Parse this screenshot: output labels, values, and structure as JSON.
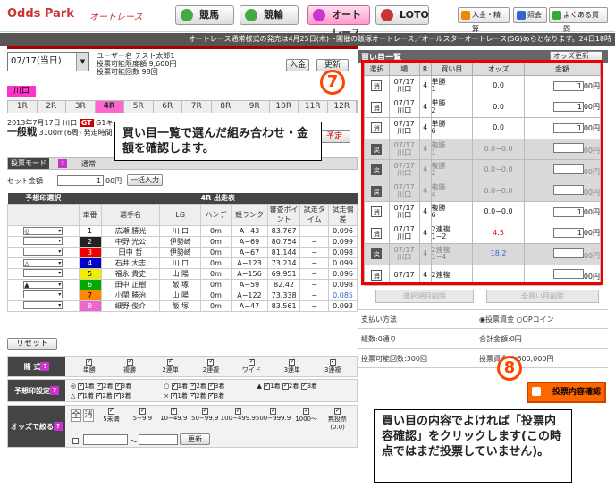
{
  "header": {
    "logo": "Odds Park",
    "sublogo": "オートレース",
    "tabs": [
      {
        "label": "競馬",
        "icon": "keiba-icon"
      },
      {
        "label": "競輪",
        "icon": "keirin-icon"
      },
      {
        "label": "オートレース",
        "icon": "autorace-icon"
      },
      {
        "label": "LOTO",
        "icon": "loto-icon"
      }
    ],
    "tools": [
      "入金・精算",
      "照会",
      "よくある質問"
    ]
  },
  "ticker": "オートレース通常様式の発売は4月25日(木)〜開催の飯塚オートレース／オールスターオートレース(SG)めらとなります。24日18時",
  "date_select": "07/17(当日)",
  "user": {
    "name": "ユーザー名 テスト太郎1",
    "limit": "投票可能限度額 9,600円",
    "count": "投票可能回数 98回"
  },
  "buttons": {
    "deposit": "入金",
    "refresh": "更新"
  },
  "venue": "川口",
  "races": [
    "1R",
    "2R",
    "3R",
    "4R",
    "5R",
    "6R",
    "7R",
    "8R",
    "9R",
    "10R",
    "11R",
    "12R"
  ],
  "race": {
    "date": "2013年7月17日 川口",
    "grade": "GT",
    "grade2": "G1キ",
    "class": "一般戦",
    "detail": "3100m(6周) 発走時間",
    "schedule": "予定"
  },
  "mode": {
    "label": "投票モード",
    "normal": "通常"
  },
  "set_amount": {
    "label": "セット金額",
    "value": "1",
    "unit": "00円",
    "bulk": "一括入力"
  },
  "entry": {
    "section": "予想印選択",
    "race_title": "4R 出走表",
    "headers": [
      "車番",
      "選手名",
      "LG",
      "ハンデ",
      "競ランク",
      "審査ポイント",
      "試走タイム",
      "試走偏差"
    ],
    "rows": [
      {
        "mark": "◎",
        "no": "1",
        "name": "広瀬 勝光",
        "lg": "川 口",
        "hande": "0m",
        "rank": "A−43",
        "pt": "83.767",
        "time": "−",
        "dev": "0.096",
        "color": "#fff",
        "fg": "#000"
      },
      {
        "mark": "",
        "no": "2",
        "name": "中野 光公",
        "lg": "伊勢崎",
        "hande": "0m",
        "rank": "A−69",
        "pt": "80.754",
        "time": "−",
        "dev": "0.099",
        "color": "#222",
        "fg": "#fff"
      },
      {
        "mark": "",
        "no": "3",
        "name": "田中 哲",
        "lg": "伊勢崎",
        "hande": "0m",
        "rank": "A−67",
        "pt": "81.144",
        "time": "−",
        "dev": "0.098",
        "color": "#e00",
        "fg": "#fff"
      },
      {
        "mark": "△",
        "no": "4",
        "name": "石井 大志",
        "lg": "川 口",
        "hande": "0m",
        "rank": "A−123",
        "pt": "73.214",
        "time": "−",
        "dev": "0.099",
        "color": "#00c",
        "fg": "#fff"
      },
      {
        "mark": "",
        "no": "5",
        "name": "福永 貴史",
        "lg": "山 陽",
        "hande": "0m",
        "rank": "A−156",
        "pt": "69.951",
        "time": "−",
        "dev": "0.096",
        "color": "#ee0",
        "fg": "#000"
      },
      {
        "mark": "▲",
        "no": "6",
        "name": "田中 正樹",
        "lg": "飯 塚",
        "hande": "0m",
        "rank": "A−59",
        "pt": "82.42",
        "time": "−",
        "dev": "0.098",
        "color": "#0a0",
        "fg": "#fff"
      },
      {
        "mark": "",
        "no": "7",
        "name": "小関 勝治",
        "lg": "山 陽",
        "hande": "0m",
        "rank": "A−122",
        "pt": "73.338",
        "time": "−",
        "dev": "0.085",
        "color": "#f80",
        "fg": "#000"
      },
      {
        "mark": "",
        "no": "8",
        "name": "細野 俊介",
        "lg": "飯 塚",
        "hande": "0m",
        "rank": "A−47",
        "pt": "83.561",
        "time": "−",
        "dev": "0.093",
        "color": "#e6c",
        "fg": "#fff"
      }
    ]
  },
  "reset": "リセット",
  "bet_types": {
    "label": "賭 式",
    "items": [
      "単勝",
      "複勝",
      "2連単",
      "2連複",
      "ワイド",
      "3連単",
      "3連複"
    ]
  },
  "mark_settings": {
    "label": "予想印設定",
    "groups": [
      [
        "◎",
        "1着",
        "2着",
        "3着"
      ],
      [
        "○",
        "1着",
        "2着",
        "3着"
      ],
      [
        "▲",
        "1着",
        "2着",
        "3着"
      ],
      [
        "△",
        "1着",
        "2着",
        "3着"
      ],
      [
        "×",
        "1着",
        "2着",
        "3着"
      ]
    ]
  },
  "odds_filter": {
    "label": "オッズで絞る",
    "all": "全",
    "clear": "消",
    "ranges": [
      "5未満",
      "5−9.9",
      "10−49.9",
      "50−99.9",
      "100−499.9",
      "500−999.9",
      "1000〜",
      "無投票(0.0)"
    ],
    "refresh": "更新"
  },
  "panel": {
    "title": "買い目一覧",
    "odds_update": "オッズ更新",
    "headers": [
      "選択",
      "場",
      "R",
      "買い目",
      "オッズ",
      "金額"
    ],
    "bets": [
      {
        "btn": "消",
        "date": "07/17",
        "venue": "川口",
        "r": "4",
        "type": "単勝",
        "combo": "1",
        "odds": "0.0",
        "amt": "1",
        "unit": "00円",
        "dis": false
      },
      {
        "btn": "消",
        "date": "07/17",
        "venue": "川口",
        "r": "4",
        "type": "単勝",
        "combo": "2",
        "odds": "0.0",
        "amt": "1",
        "unit": "00円",
        "dis": false
      },
      {
        "btn": "消",
        "date": "07/17",
        "venue": "川口",
        "r": "4",
        "type": "単勝",
        "combo": "6",
        "odds": "0.0",
        "amt": "1",
        "unit": "00円",
        "dis": false
      },
      {
        "btn": "戻",
        "date": "07/17",
        "venue": "川口",
        "r": "4",
        "type": "複勝",
        "combo": "1",
        "odds": "0.0−0.0",
        "amt": "",
        "unit": "00円",
        "dis": true
      },
      {
        "btn": "戻",
        "date": "07/17",
        "venue": "川口",
        "r": "4",
        "type": "複勝",
        "combo": "2",
        "odds": "0.0−0.0",
        "amt": "",
        "unit": "00円",
        "dis": true
      },
      {
        "btn": "戻",
        "date": "07/17",
        "venue": "川口",
        "r": "4",
        "type": "複勝",
        "combo": "4",
        "odds": "0.0−0.0",
        "amt": "",
        "unit": "00円",
        "dis": true
      },
      {
        "btn": "消",
        "date": "07/17",
        "venue": "川口",
        "r": "4",
        "type": "複勝",
        "combo": "6",
        "odds": "0.0−0.0",
        "amt": "1",
        "unit": "00円",
        "dis": false
      },
      {
        "btn": "消",
        "date": "07/17",
        "venue": "川口",
        "r": "4",
        "type": "2連複",
        "combo": "1−2",
        "odds": "4.5",
        "amt": "1",
        "unit": "00円",
        "dis": false,
        "oc": "#e00"
      },
      {
        "btn": "戻",
        "date": "07/17",
        "venue": "川口",
        "r": "4",
        "type": "2連複",
        "combo": "1−4",
        "odds": "18.2",
        "amt": "",
        "unit": "00円",
        "dis": true,
        "oc": "#36c"
      },
      {
        "btn": "消",
        "date": "07/17",
        "venue": "",
        "r": "4",
        "type": "2連複",
        "combo": "",
        "odds": "",
        "amt": "",
        "unit": "00円",
        "dis": false
      }
    ],
    "delete_selected": "選択項目削除",
    "delete_all": "全買い目削除",
    "pay_label": "支払い方法",
    "pay1": "投票資金",
    "pay2": "OPコイン",
    "count": "組数:0通り",
    "total": "合計金額:0円",
    "remaining": "投票可能回数:300回",
    "funds": "投票資金:9,600,000円",
    "confirm": "投票内容確認"
  },
  "callout7": {
    "num": "7",
    "text": "買い目一覧で選んだ組み合わせ・金額を確認します。"
  },
  "callout8": {
    "num": "8",
    "text": "買い目の内容でよければ「投票内容確認」をクリックします(この時点ではまだ投票していません)。"
  }
}
